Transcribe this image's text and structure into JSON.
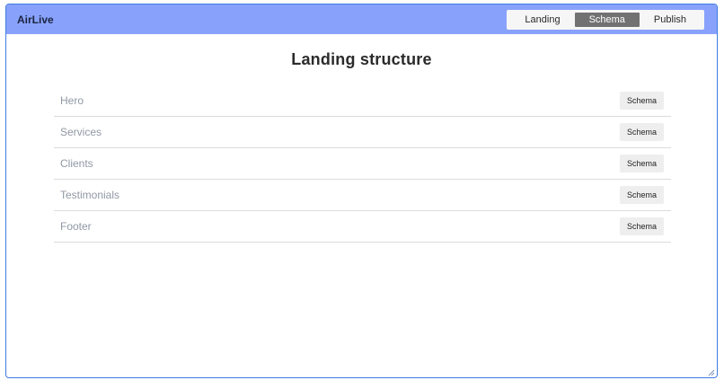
{
  "app": {
    "name": "AirLive"
  },
  "nav": {
    "tabs": [
      {
        "label": "Landing",
        "active": false
      },
      {
        "label": "Schema",
        "active": true
      },
      {
        "label": "Publish",
        "active": false
      }
    ]
  },
  "main": {
    "title": "Landing structure",
    "sections": [
      {
        "label": "Hero",
        "action": "Schema"
      },
      {
        "label": "Services",
        "action": "Schema"
      },
      {
        "label": "Clients",
        "action": "Schema"
      },
      {
        "label": "Testimonials",
        "action": "Schema"
      },
      {
        "label": "Footer",
        "action": "Schema"
      }
    ]
  },
  "colors": {
    "topbar": "#88a2fc",
    "window_border": "#3d7be0",
    "active_tab": "#727272"
  }
}
